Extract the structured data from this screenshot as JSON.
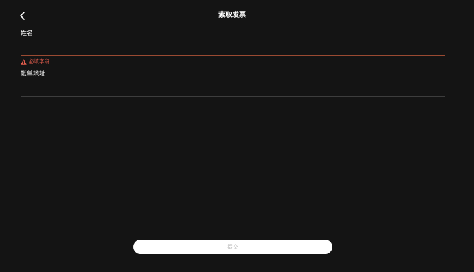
{
  "header": {
    "title": "索取发票",
    "back_icon": "chevron-left-icon"
  },
  "form": {
    "name_field": {
      "label": "姓名",
      "value": "",
      "placeholder": "",
      "error": "必填字段",
      "error_icon": "warning-triangle-icon"
    },
    "billing_address_field": {
      "label": "帐单地址",
      "value": "",
      "placeholder": ""
    }
  },
  "actions": {
    "submit_label": "提交"
  },
  "colors": {
    "background": "#141414",
    "text": "#ffffff",
    "error": "#e35d4d",
    "error_underline": "#9a4a32",
    "divider": "#3a3a3a",
    "button_bg": "#ffffff",
    "button_text_disabled": "#b8b8b8"
  }
}
